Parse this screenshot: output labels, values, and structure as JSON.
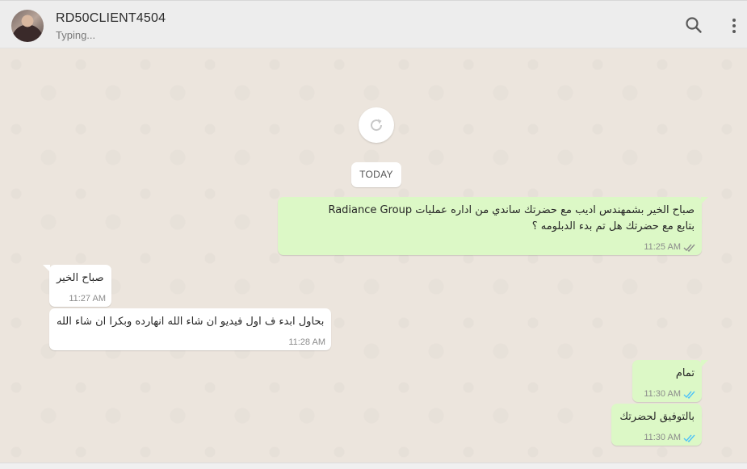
{
  "header": {
    "contact_name": "RD50CLIENT4504",
    "status": "Typing..."
  },
  "icons": {
    "search": "search-icon",
    "menu": "more-vertical-icon",
    "refresh": "refresh-icon",
    "avatar": "contact-avatar"
  },
  "colors": {
    "outgoing_bubble": "#dcf8c6",
    "incoming_bubble": "#ffffff",
    "read_tick": "#4fc3f7",
    "delivered_tick": "#8c8c8c"
  },
  "date_separator": "TODAY",
  "messages": [
    {
      "direction": "out",
      "line1": "صباح الخير بشمهندس اديب مع حضرتك ساندي من اداره عمليات Radiance Group",
      "line2": "بتابع مع حضرتك هل تم بدء الدبلومه ؟",
      "time": "11:25 AM",
      "ticks": "delivered"
    },
    {
      "direction": "in",
      "text": "صباح الخير",
      "time": "11:27 AM"
    },
    {
      "direction": "in",
      "text": "بحاول ابدء ف اول فيديو ان شاء الله انهارده وبكرا ان شاء الله",
      "time": "11:28 AM"
    },
    {
      "direction": "out",
      "text": "تمام",
      "time": "11:30 AM",
      "ticks": "read"
    },
    {
      "direction": "out",
      "text": "بالتوفيق لحضرتك",
      "time": "11:30 AM",
      "ticks": "read"
    }
  ]
}
